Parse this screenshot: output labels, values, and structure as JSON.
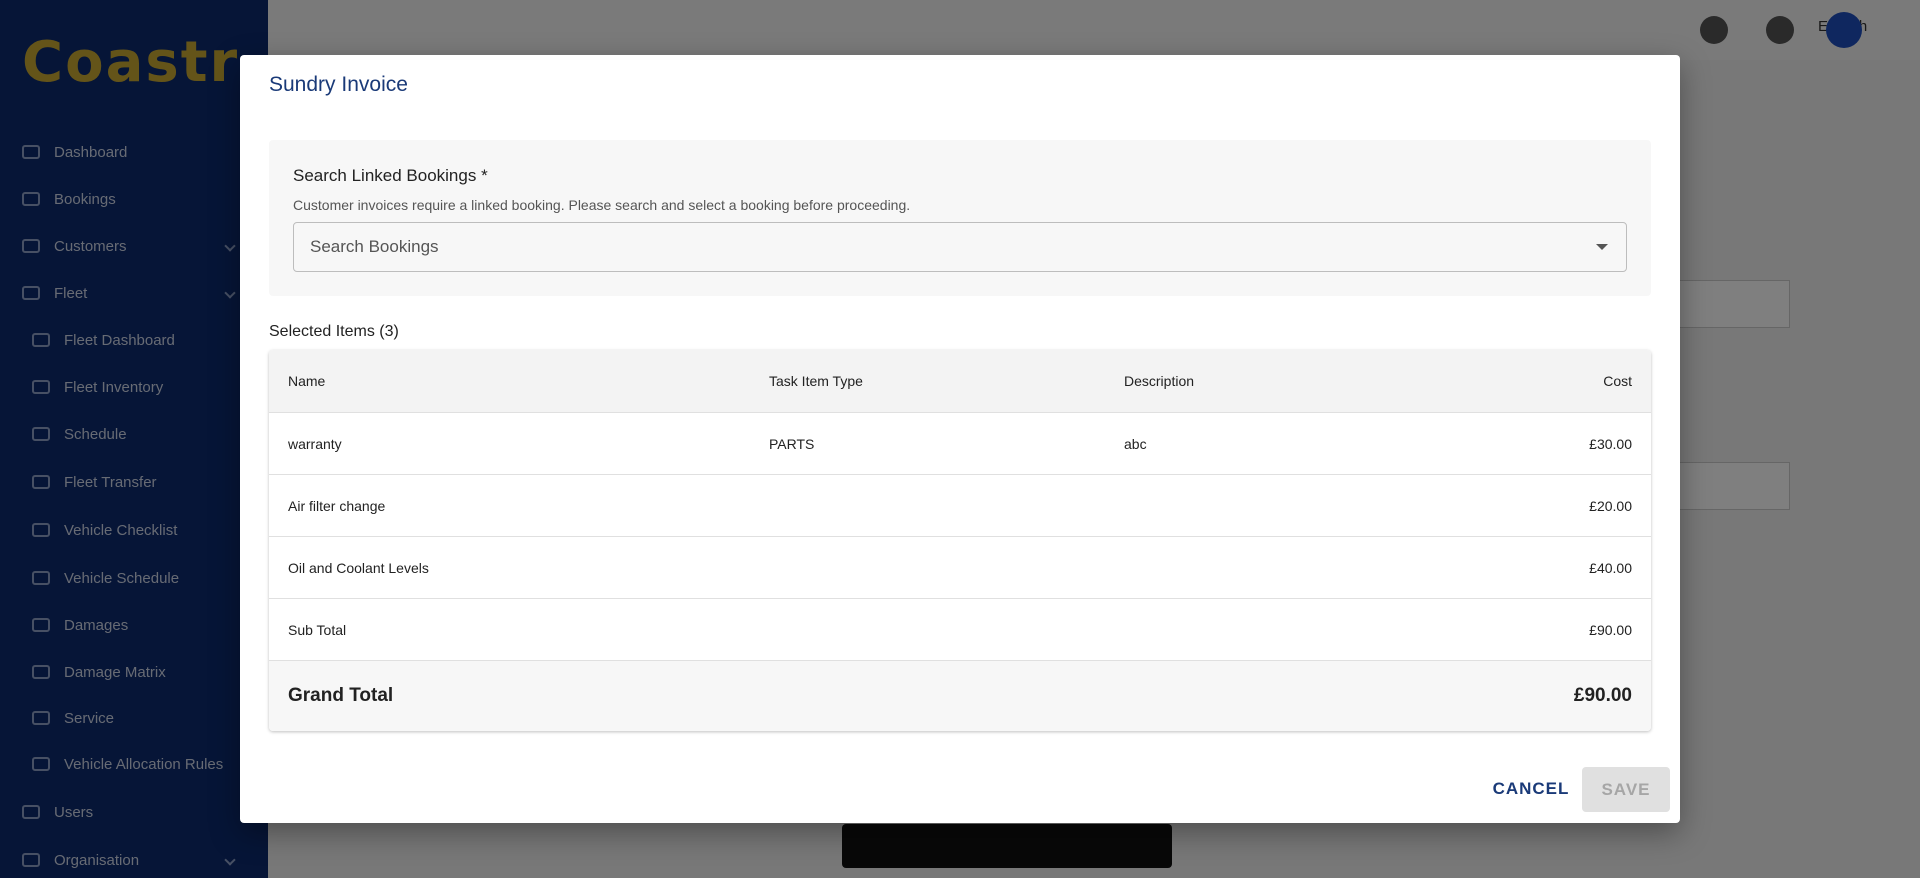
{
  "background": {
    "brand": "Coastr",
    "brand_tagline": "",
    "language": "English",
    "nav": [
      "Dashboard",
      "Bookings",
      "Customers",
      "Fleet",
      "Fleet Dashboard",
      "Fleet Inventory",
      "Schedule",
      "Fleet Transfer",
      "Vehicle Checklist",
      "Vehicle Schedule",
      "Damages",
      "Damage Matrix",
      "Service",
      "Vehicle Allocation Rules",
      "Users",
      "Organisation"
    ]
  },
  "dialog": {
    "title": "Sundry Invoice",
    "search": {
      "label": "Search Linked Bookings *",
      "helper": "Customer invoices require a linked booking. Please search and select a booking before proceeding.",
      "placeholder": "Search Bookings",
      "value": ""
    },
    "selected_heading": "Selected Items (3)",
    "table": {
      "headers": {
        "name": "Name",
        "type": "Task Item Type",
        "description": "Description",
        "cost": "Cost"
      },
      "rows": [
        {
          "name": "warranty",
          "type": "PARTS",
          "description": "abc",
          "cost": "£30.00"
        },
        {
          "name": "Air filter change",
          "type": "",
          "description": "",
          "cost": "£20.00"
        },
        {
          "name": "Oil and Coolant Levels",
          "type": "",
          "description": "",
          "cost": "£40.00"
        }
      ],
      "sub_total": {
        "label": "Sub Total",
        "value": "£90.00"
      },
      "grand_total": {
        "label": "Grand Total",
        "value": "£90.00"
      }
    },
    "actions": {
      "cancel": "CANCEL",
      "save": "SAVE",
      "save_disabled": true
    }
  },
  "colors": {
    "accent": "#1a3a78",
    "sidebar": "#0d2a6e",
    "disabled_bg": "#e0e0e0",
    "disabled_text": "#a6a6a6"
  }
}
